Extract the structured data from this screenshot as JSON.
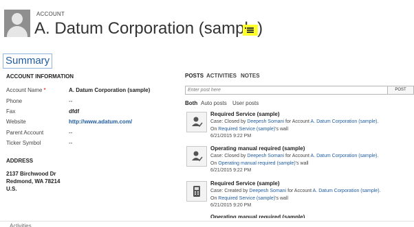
{
  "header": {
    "entity_type": "ACCOUNT",
    "entity_name": "A. Datum Corporation (sample)"
  },
  "tab": {
    "label": "Summary"
  },
  "account_info": {
    "title": "ACCOUNT INFORMATION",
    "fields": [
      {
        "label": "Account Name",
        "required_mark": "*",
        "value": "A. Datum Corporation (sample)"
      },
      {
        "label": "Phone",
        "value": "--"
      },
      {
        "label": "Fax",
        "value": "dfdf"
      },
      {
        "label": "Website",
        "value": "http://www.adatum.com/"
      },
      {
        "label": "Parent Account",
        "value": "--"
      },
      {
        "label": "Ticker Symbol",
        "value": "--"
      }
    ]
  },
  "address": {
    "title": "ADDRESS",
    "line1": "2137 Birchwood Dr",
    "line2": "Redmond, WA 78214",
    "line3": "U.S."
  },
  "social": {
    "tabs": [
      "POSTS",
      "ACTIVITIES",
      "NOTES"
    ],
    "post_placeholder": "Enter post here",
    "post_button": "POST",
    "filters": [
      "Both",
      "Auto posts",
      "User posts"
    ],
    "posts": [
      {
        "title": "Required Service (sample)",
        "line1_prefix": "Case: Closed by ",
        "user": "Deepesh Somani",
        "line1_mid": " for Account ",
        "account": "A. Datum Corporation (sample).",
        "line2_prefix": "On ",
        "wall_link": "Required Service (sample)",
        "line2_suffix": "'s wall",
        "date": "6/21/2015 9:22 PM"
      },
      {
        "title": "Operating manual required (sample)",
        "line1_prefix": "Case: Closed by ",
        "user": "Deepesh Somani",
        "line1_mid": " for Account ",
        "account": "A. Datum Corporation (sample).",
        "line2_prefix": "On ",
        "wall_link": "Operating manual required (sample)",
        "line2_suffix": "'s wall",
        "date": "6/21/2015 9:22 PM"
      },
      {
        "title": "Required Service (sample)",
        "line1_prefix": "Case: Created by ",
        "user": "Deepesh Somani",
        "line1_mid": " for Account ",
        "account": "A. Datum Corporation (sample).",
        "line2_prefix": "On ",
        "wall_link": "Required Service (sample)",
        "line2_suffix": "'s wall",
        "date": "6/21/2015 9:20 PM"
      }
    ],
    "cut_post_title": "Operating manual required (sample)"
  },
  "footer_cut_text": "Activities",
  "colors": {
    "link": "#1f5b9f",
    "highlight": "#ffff2e",
    "required": "#dd0000"
  }
}
